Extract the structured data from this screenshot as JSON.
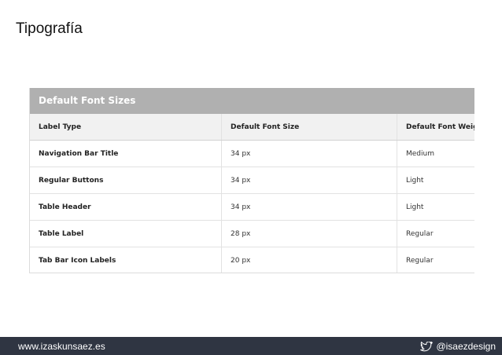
{
  "slide": {
    "title": "Tipografía"
  },
  "table": {
    "caption": "Default Font Sizes",
    "columns": [
      "Label Type",
      "Default Font Size",
      "Default Font Weight"
    ],
    "rows": [
      [
        "Navigation Bar Title",
        "34 px",
        "Medium"
      ],
      [
        "Regular Buttons",
        "34 px",
        "Light"
      ],
      [
        "Table Header",
        "34 px",
        "Light"
      ],
      [
        "Table Label",
        "28 px",
        "Regular"
      ],
      [
        "Tab Bar Icon Labels",
        "20 px",
        "Regular"
      ]
    ]
  },
  "footer": {
    "website": "www.izaskunsaez.es",
    "handle": "@isaezdesign",
    "icon": "twitter-bird-icon"
  },
  "colors": {
    "footer_bg": "#2f3542",
    "caption_bg": "#b0b0b0",
    "header_bg": "#f1f1f1"
  }
}
